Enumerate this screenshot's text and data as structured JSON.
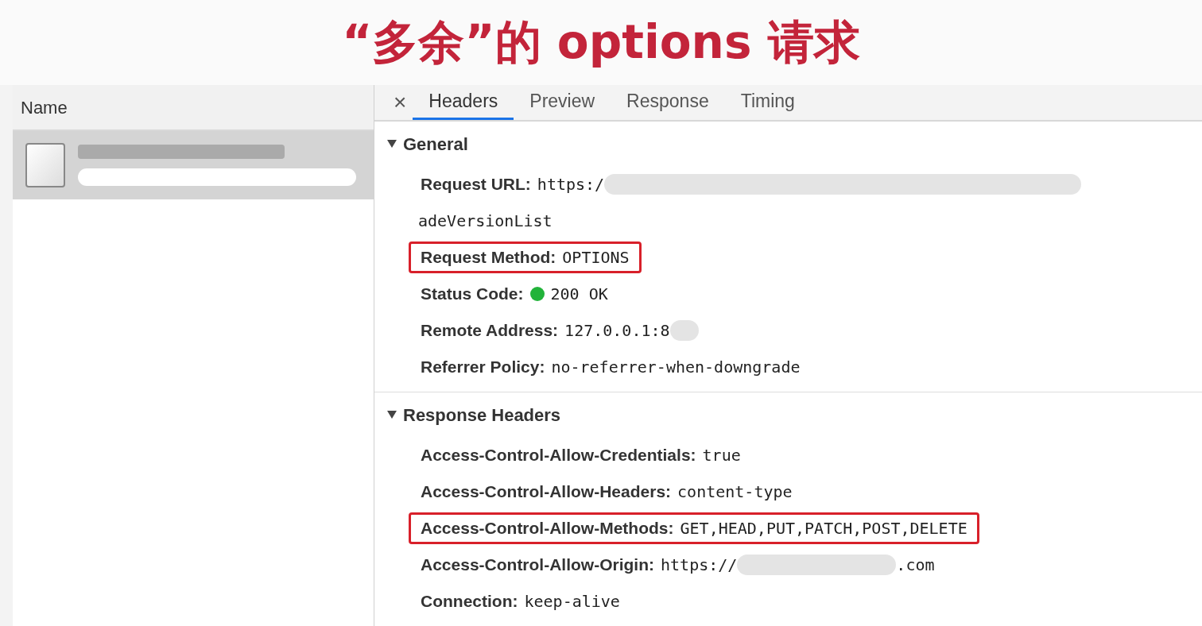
{
  "caption": "“多余”的 options 请求",
  "requests": {
    "column": "Name",
    "rows": [
      {
        "selected": true
      }
    ]
  },
  "detail": {
    "close": "×",
    "tabs": [
      {
        "label": "Headers",
        "selected": true
      },
      {
        "label": "Preview",
        "selected": false
      },
      {
        "label": "Response",
        "selected": false
      },
      {
        "label": "Timing",
        "selected": false
      }
    ],
    "sections": [
      {
        "title": "General",
        "expanded": true,
        "rows": [
          {
            "label": "Request URL:",
            "parts": [
              {
                "kind": "text",
                "text": "https:/"
              },
              {
                "kind": "redacted-long"
              }
            ],
            "continuation": "adeVersionList",
            "highlighted": false
          },
          {
            "label": "Request Method:",
            "parts": [
              {
                "kind": "text",
                "text": "OPTIONS"
              }
            ],
            "highlighted": true
          },
          {
            "label": "Status Code:",
            "parts": [
              {
                "kind": "dot",
                "color": "#22b33a"
              },
              {
                "kind": "text",
                "text": "200 OK"
              }
            ],
            "highlighted": false
          },
          {
            "label": "Remote Address:",
            "parts": [
              {
                "kind": "text",
                "text": "127.0.0.1:8"
              },
              {
                "kind": "redacted-short"
              }
            ],
            "highlighted": false
          },
          {
            "label": "Referrer Policy:",
            "parts": [
              {
                "kind": "text",
                "text": "no-referrer-when-downgrade"
              }
            ],
            "highlighted": false
          }
        ]
      },
      {
        "title": "Response Headers",
        "expanded": true,
        "rows": [
          {
            "label": "Access-Control-Allow-Credentials:",
            "parts": [
              {
                "kind": "text",
                "text": "true"
              }
            ],
            "highlighted": false
          },
          {
            "label": "Access-Control-Allow-Headers:",
            "parts": [
              {
                "kind": "text",
                "text": "content-type"
              }
            ],
            "highlighted": false
          },
          {
            "label": "Access-Control-Allow-Methods:",
            "parts": [
              {
                "kind": "text",
                "text": "GET,HEAD,PUT,PATCH,POST,DELETE"
              }
            ],
            "highlighted": true
          },
          {
            "label": "Access-Control-Allow-Origin:",
            "parts": [
              {
                "kind": "text",
                "text": "https://"
              },
              {
                "kind": "redacted-medium"
              },
              {
                "kind": "text",
                "text": ".com"
              }
            ],
            "highlighted": false
          },
          {
            "label": "Connection:",
            "parts": [
              {
                "kind": "text",
                "text": "keep-alive"
              }
            ],
            "highlighted": false
          }
        ]
      }
    ]
  }
}
